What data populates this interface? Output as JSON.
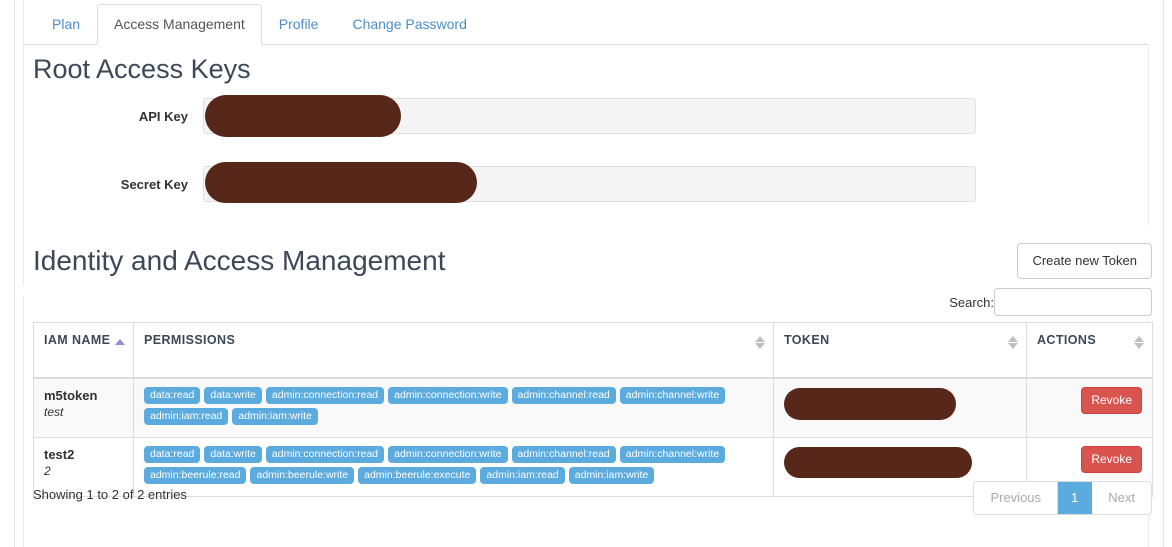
{
  "tabs": [
    {
      "label": "Plan",
      "active": false
    },
    {
      "label": "Access Management",
      "active": true
    },
    {
      "label": "Profile",
      "active": false
    },
    {
      "label": "Change Password",
      "active": false
    }
  ],
  "root_access_keys": {
    "title": "Root Access Keys",
    "fields": [
      {
        "label": "API Key",
        "value": "",
        "redacted": true
      },
      {
        "label": "Secret Key",
        "value": "",
        "redacted": true
      }
    ]
  },
  "iam": {
    "title": "Identity and Access Management",
    "create_token_label": "Create new Token",
    "search": {
      "label": "Search:",
      "value": "",
      "placeholder": ""
    },
    "columns": [
      {
        "key": "iam_name",
        "label": "IAM NAME",
        "sort": "asc"
      },
      {
        "key": "permissions",
        "label": "PERMISSIONS",
        "sort": "none"
      },
      {
        "key": "token",
        "label": "TOKEN",
        "sort": "none"
      },
      {
        "key": "actions",
        "label": "ACTIONS",
        "sort": "none"
      }
    ],
    "rows": [
      {
        "name": "m5token",
        "description": "test",
        "permissions": [
          "data:read",
          "data:write",
          "admin:connection:read",
          "admin:connection:write",
          "admin:channel:read",
          "admin:channel:write",
          "admin:iam:read",
          "admin:iam:write"
        ],
        "token": "",
        "token_redacted": true,
        "action_label": "Revoke"
      },
      {
        "name": "test2",
        "description": "2",
        "permissions": [
          "data:read",
          "data:write",
          "admin:connection:read",
          "admin:connection:write",
          "admin:channel:read",
          "admin:channel:write",
          "admin:beerule:read",
          "admin:beerule:write",
          "admin:beerule:execute",
          "admin:iam:read",
          "admin:iam:write"
        ],
        "token": "",
        "token_redacted": true,
        "action_label": "Revoke"
      }
    ],
    "footer": {
      "showing": "Showing 1 to 2 of 2 entries",
      "pagination": {
        "previous_label": "Previous",
        "pages": [
          "1"
        ],
        "current_page": "1",
        "next_label": "Next"
      }
    }
  },
  "colors": {
    "tab_link": "#4c8ec9",
    "heading": "#3c4858",
    "tag_blue": "#5babdf",
    "revoke_red": "#d9534f",
    "redaction": "#57271a",
    "pagination_active": "#5babdf"
  }
}
